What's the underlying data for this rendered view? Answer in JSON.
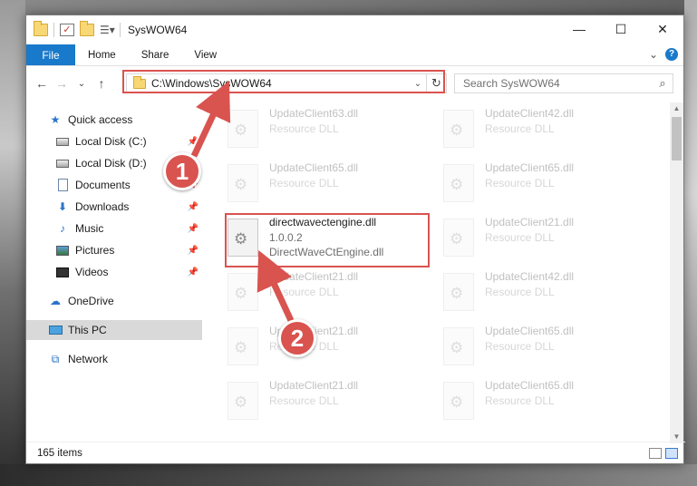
{
  "window": {
    "title": "SysWOW64",
    "minimize": "—",
    "maximize": "☐",
    "close": "✕"
  },
  "ribbon": {
    "tabs": [
      "File",
      "Home",
      "Share",
      "View"
    ],
    "expand": "⌄",
    "help": "?"
  },
  "nav": {
    "back": "←",
    "forward": "→",
    "recent": "⌄",
    "up": "↑",
    "address": "C:\\Windows\\SysWOW64",
    "search_placeholder": "Search SysWOW64"
  },
  "sidebar": {
    "items": [
      {
        "label": "Quick access",
        "pinned": false
      },
      {
        "label": "Local Disk (C:)",
        "pinned": true
      },
      {
        "label": "Local Disk (D:)",
        "pinned": true
      },
      {
        "label": "Documents",
        "pinned": true
      },
      {
        "label": "Downloads",
        "pinned": true
      },
      {
        "label": "Music",
        "pinned": true
      },
      {
        "label": "Pictures",
        "pinned": true
      },
      {
        "label": "Videos",
        "pinned": true
      },
      {
        "label": "OneDrive",
        "pinned": false
      },
      {
        "label": "This PC",
        "pinned": false
      },
      {
        "label": "Network",
        "pinned": false
      }
    ]
  },
  "files": {
    "left": [
      {
        "name": "UpdateClient63.dll",
        "meta": "Resource DLL"
      },
      {
        "name": "UpdateClient65.dll",
        "meta": "Resource DLL"
      },
      {
        "name": "UpdateClient21.dll",
        "meta": "Resource DLL"
      },
      {
        "name": "UpdateClient21.dll",
        "meta": "Resource DLL"
      },
      {
        "name": "UpdateClient21.dll",
        "meta": "Resource DLL"
      }
    ],
    "right": [
      {
        "name": "UpdateClient42.dll",
        "meta": "Resource DLL"
      },
      {
        "name": "UpdateClient65.dll",
        "meta": "Resource DLL"
      },
      {
        "name": "UpdateClient21.dll",
        "meta": "Resource DLL"
      },
      {
        "name": "UpdateClient42.dll",
        "meta": "Resource DLL"
      },
      {
        "name": "UpdateClient65.dll",
        "meta": "Resource DLL"
      },
      {
        "name": "UpdateClient65.dll",
        "meta": "Resource DLL"
      }
    ],
    "highlighted": {
      "name": "directwavectengine.dll",
      "version": "1.0.0.2",
      "description": "DirectWaveCtEngine.dll"
    }
  },
  "status": {
    "item_count": "165 items"
  },
  "annotations": {
    "step1": "1",
    "step2": "2",
    "color": "#d9534f"
  }
}
